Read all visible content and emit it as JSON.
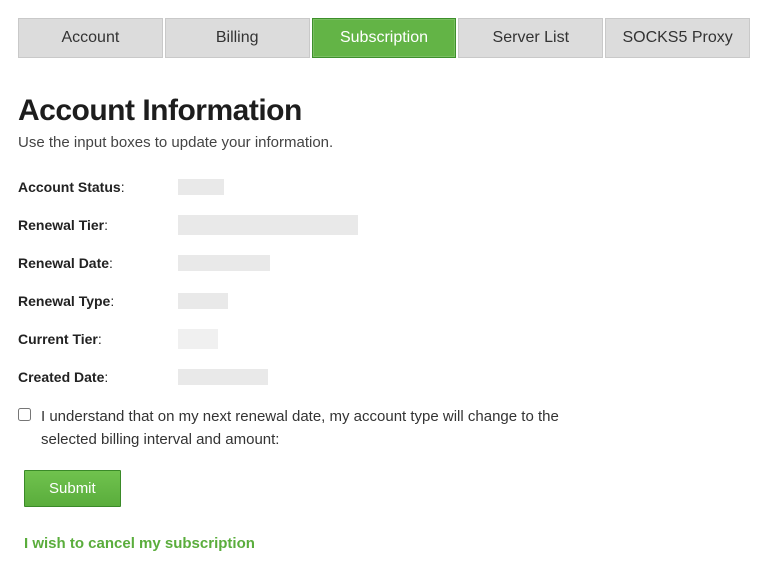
{
  "tabs": {
    "account": "Account",
    "billing": "Billing",
    "subscription": "Subscription",
    "server_list": "Server List",
    "socks5": "SOCKS5 Proxy",
    "active": "subscription"
  },
  "heading": "Account Information",
  "subtitle": "Use the input boxes to update your information.",
  "fields": {
    "account_status": {
      "label": "Account Status",
      "value": ""
    },
    "renewal_tier": {
      "label": "Renewal Tier",
      "value": ""
    },
    "renewal_date": {
      "label": "Renewal Date",
      "value": ""
    },
    "renewal_type": {
      "label": "Renewal Type",
      "value": ""
    },
    "current_tier": {
      "label": "Current Tier",
      "value": ""
    },
    "created_date": {
      "label": "Created Date",
      "value": ""
    }
  },
  "consent_text": "I understand that on my next renewal date, my account type will change to the selected billing interval and amount:",
  "submit_label": "Submit",
  "cancel_link": "I wish to cancel my subscription"
}
